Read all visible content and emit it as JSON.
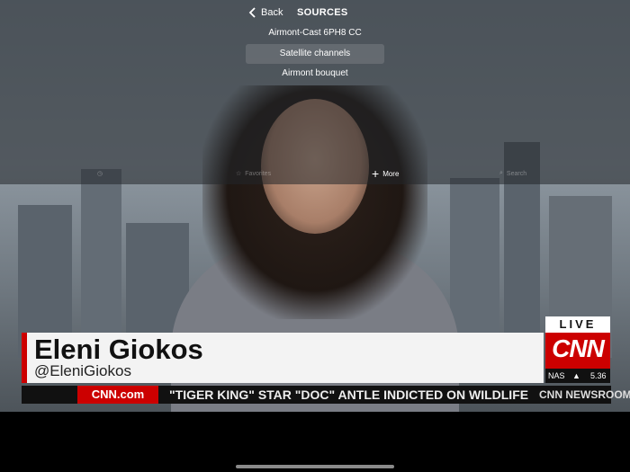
{
  "nav": {
    "back_label": "Back",
    "title": "SOURCES"
  },
  "sources": [
    {
      "label": "Airmont-Cast 6PH8 CC",
      "selected": false
    },
    {
      "label": "Satellite channels",
      "selected": true
    },
    {
      "label": "Airmont bouquet",
      "selected": false
    }
  ],
  "toolbar": {
    "favorites_label": "Favorites",
    "more_label": "More",
    "search_label": "Search"
  },
  "lower_third": {
    "name": "Eleni Giokos",
    "handle": "@EleniGiokos",
    "ticker_site": "CNN.com",
    "ticker_headline": "\"TIGER KING\" STAR \"DOC\" ANTLE INDICTED ON WILDLIFE",
    "show": "CNN NEWSROOM",
    "live_label": "LIVE",
    "network": "CNN",
    "market_index": "NAS",
    "market_change": "5.36"
  },
  "colors": {
    "accent_red": "#cc0000",
    "overlay": "#23262a"
  }
}
